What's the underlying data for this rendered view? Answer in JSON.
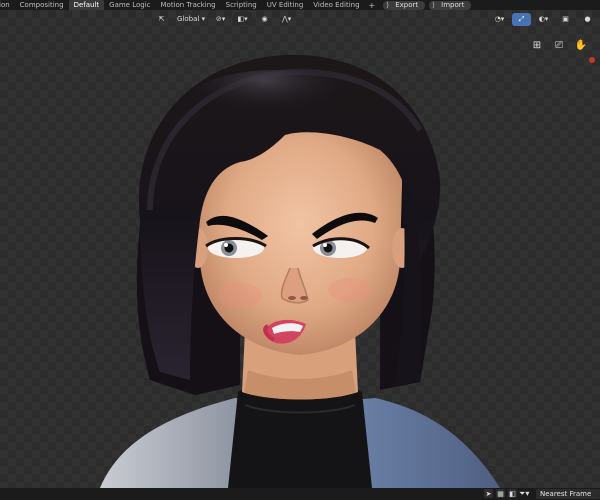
{
  "workspace_tabs": [
    {
      "label": "ion",
      "active": false
    },
    {
      "label": "Compositing",
      "active": false
    },
    {
      "label": "Default",
      "active": true
    },
    {
      "label": "Game Logic",
      "active": false
    },
    {
      "label": "Motion Tracking",
      "active": false
    },
    {
      "label": "Scripting",
      "active": false
    },
    {
      "label": "UV Editing",
      "active": false
    },
    {
      "label": "Video Editing",
      "active": false
    }
  ],
  "add_tab_symbol": "+",
  "actions": {
    "export_label": "Export",
    "import_label": "Import"
  },
  "viewport_header": {
    "orientation_label": "Global",
    "icons": [
      "transform-orientation-icon",
      "pivot-icon",
      "snap-icon",
      "proportional-edit-icon",
      "falloff-icon",
      "visibility-icon",
      "gizmo-icon",
      "overlay-icon",
      "shading-solid-icon",
      "shading-material-icon",
      "shading-rendered-icon"
    ]
  },
  "navigation_gizmos": [
    "grid-icon",
    "camera-icon",
    "hand-pan-icon",
    "zoom-icon"
  ],
  "status_bar": {
    "frame_mode": "Nearest Frame"
  },
  "colors": {
    "accent": "#4772b3",
    "record": "#c0392b"
  }
}
